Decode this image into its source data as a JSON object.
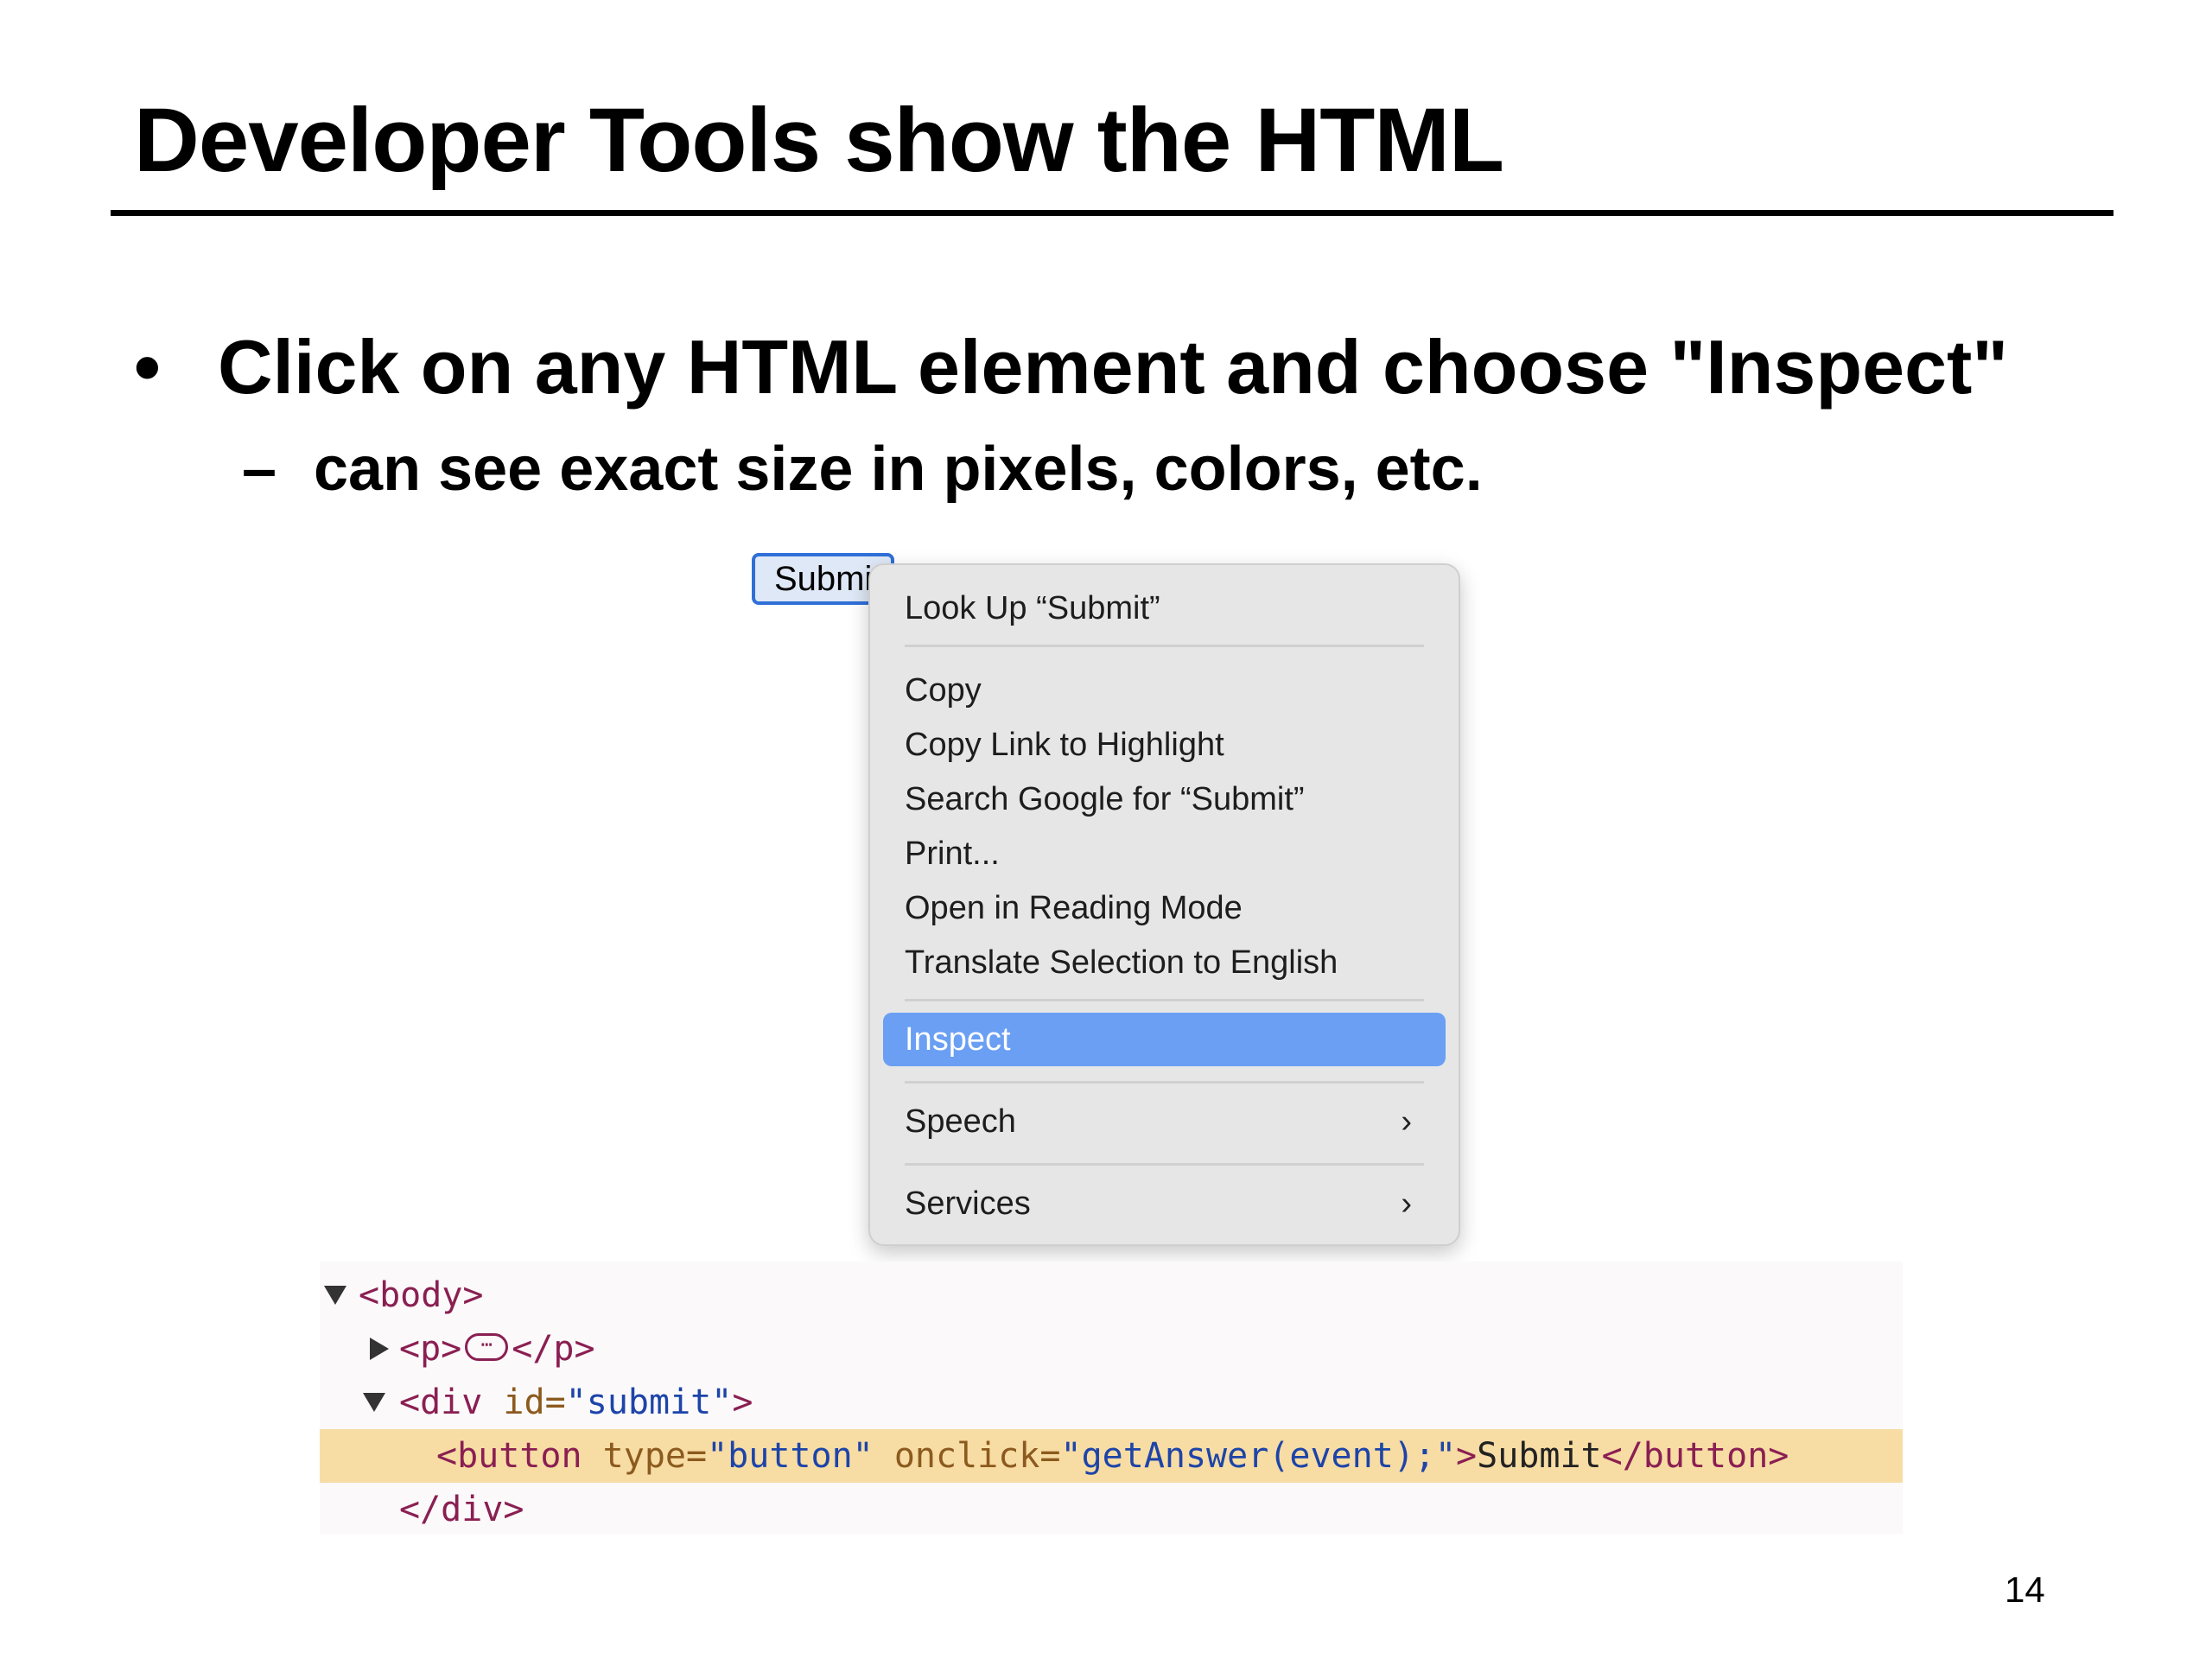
{
  "slide": {
    "title": "Developer Tools show the HTML",
    "bullet": "•",
    "bullet_text": "Click on any HTML element and choose \"Inspect\"",
    "sub_dash": "–",
    "sub_text": "can see exact size in pixels, colors, etc.",
    "page_number": "14"
  },
  "button": {
    "label": "Submit"
  },
  "context_menu": {
    "items": [
      "Look Up “Submit”",
      "Copy",
      "Copy Link to Highlight",
      "Search Google for “Submit”",
      "Print...",
      "Open in Reading Mode",
      "Translate Selection to English",
      "Inspect",
      "Speech",
      "Services"
    ],
    "active": "Inspect",
    "submenu_arrow": "›"
  },
  "devtools": {
    "body_open": "<body>",
    "p_open": "<p>",
    "p_ellipsis": "⋯",
    "p_close": "</p>",
    "div_open_start": "<div",
    "div_attr_name": " id=",
    "div_attr_value": "\"submit\"",
    "div_open_end": ">",
    "btn_open_start": "<button",
    "btn_type_name": " type=",
    "btn_type_value": "\"button\"",
    "btn_onclick_name": " onclick=",
    "btn_onclick_value": "\"getAnswer(event);\"",
    "btn_open_end": ">",
    "btn_text": "Submit",
    "btn_close": "</button>",
    "div_close": "</div>"
  },
  "colors": {
    "menu_highlight": "#6a9ff3",
    "selected_row": "#f7dca4",
    "tag": "#8a1f52",
    "attr_value": "#1d44a8"
  }
}
